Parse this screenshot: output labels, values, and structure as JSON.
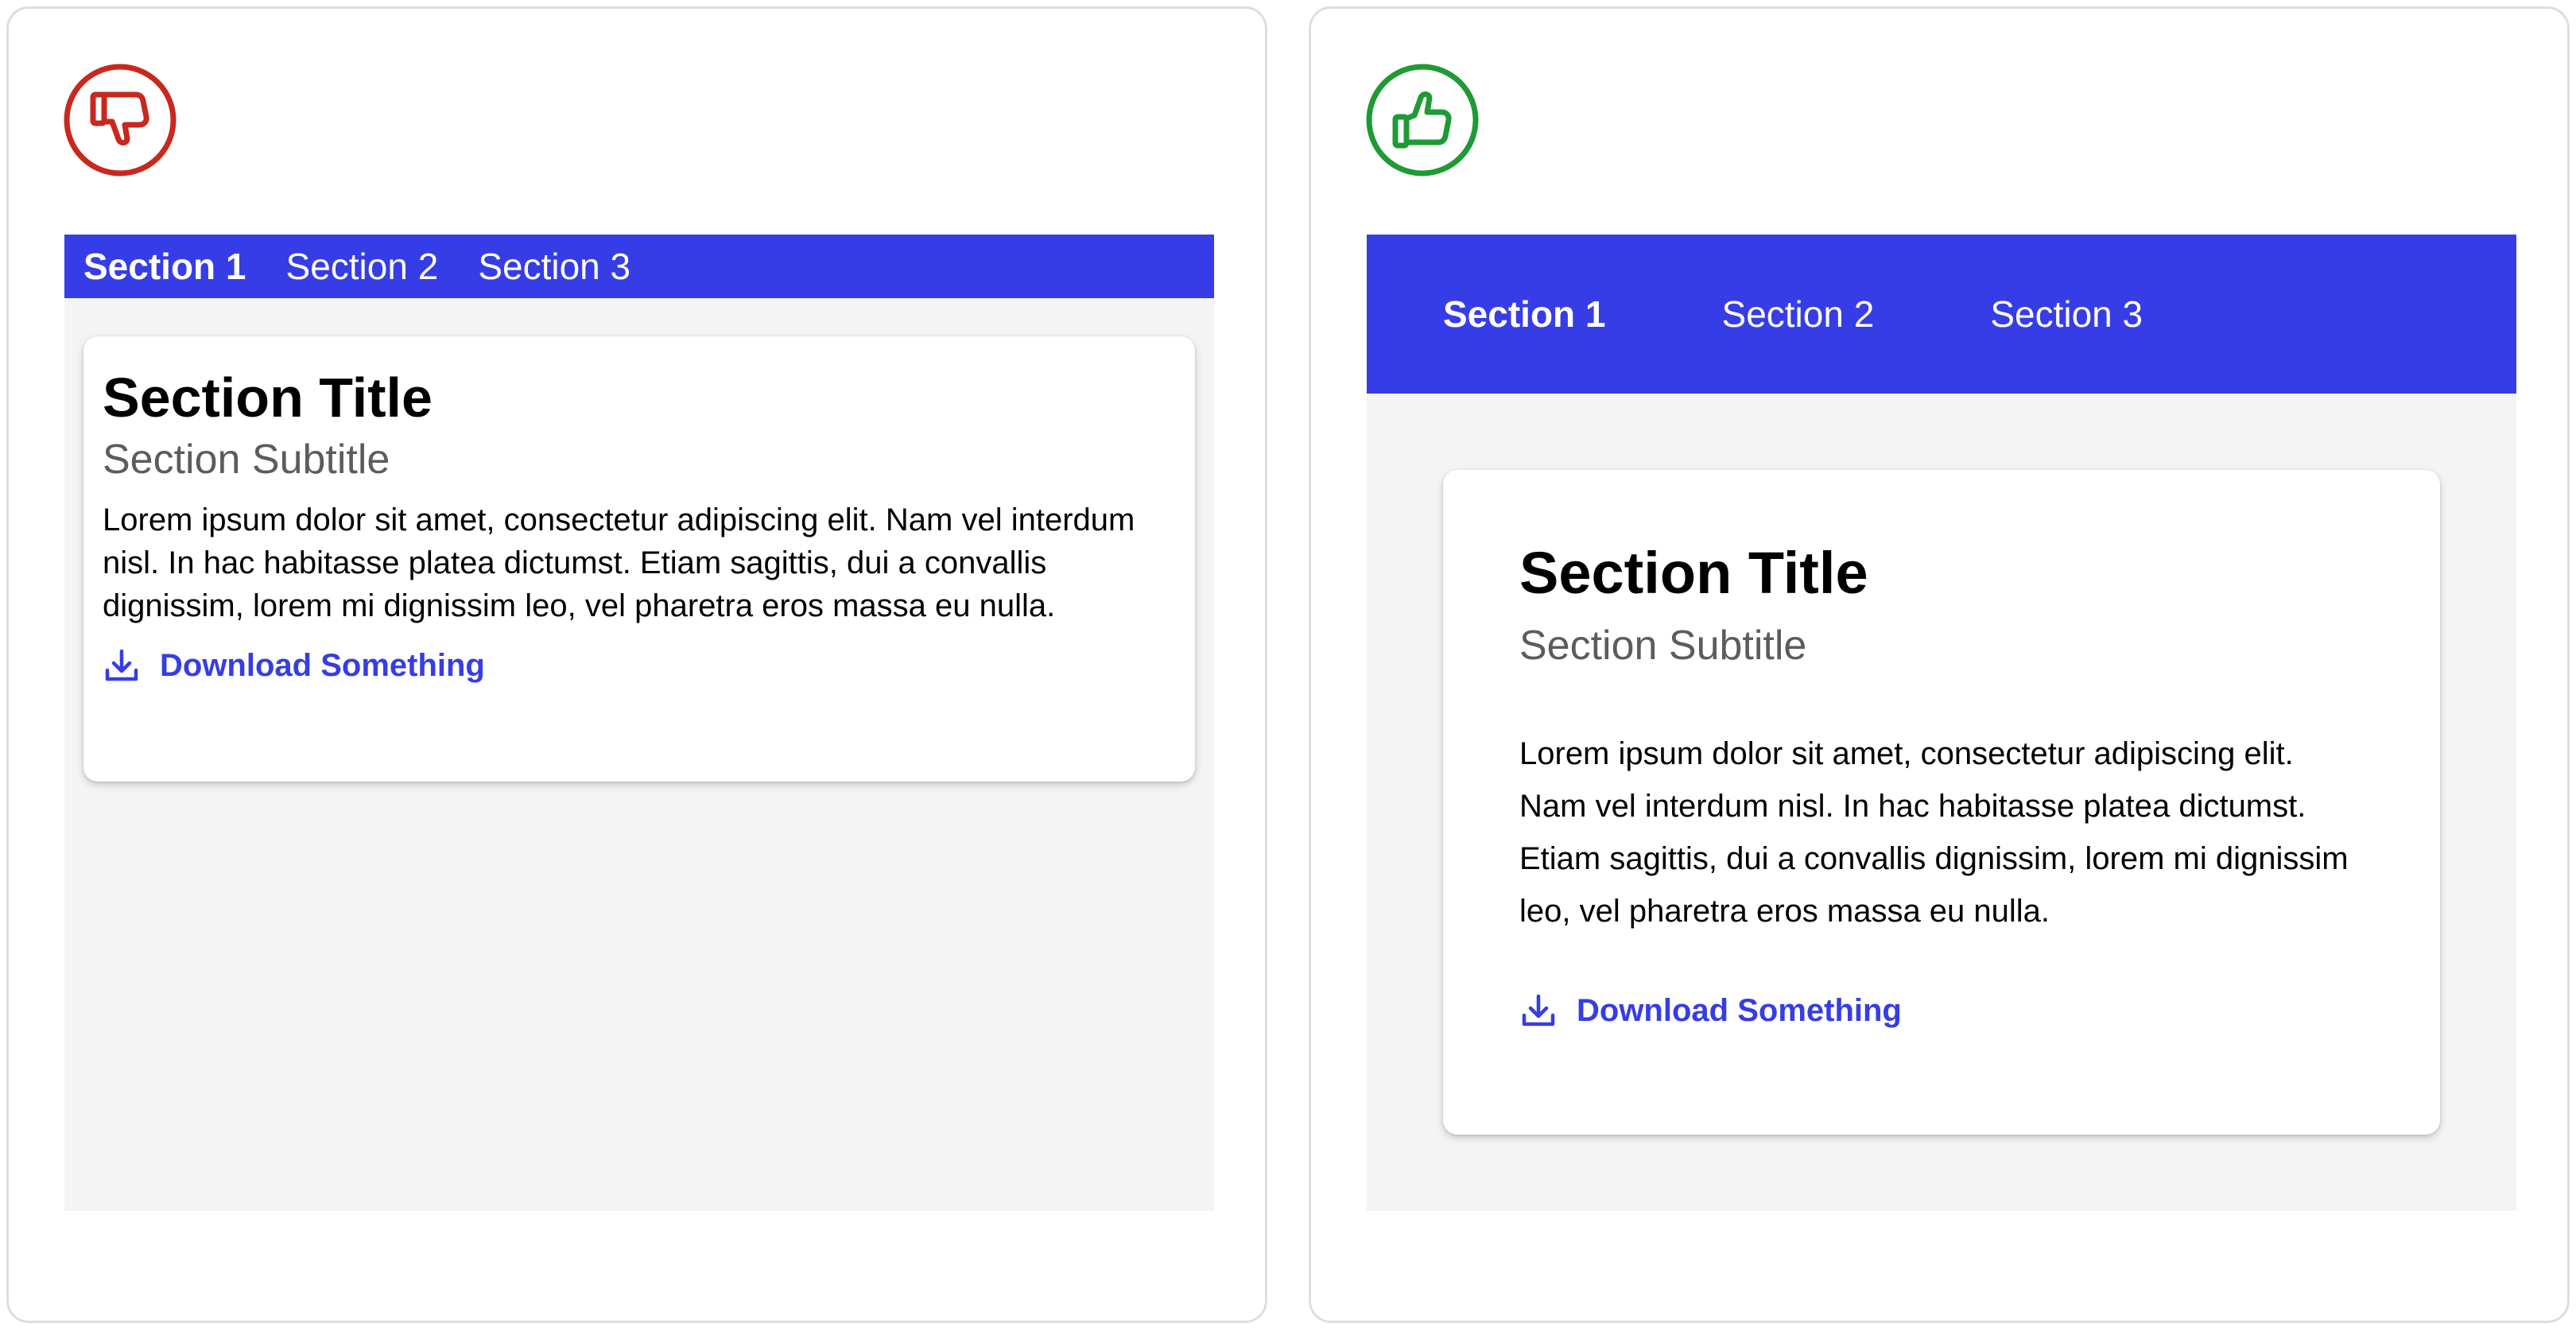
{
  "colors": {
    "nav_background": "#363de6",
    "content_background": "#f4f4f4",
    "link": "#363de6",
    "bad": "#c8281e",
    "good": "#1f9a34",
    "subtitle": "#5c5c5c"
  },
  "bad_example": {
    "verdict_icon": "thumbs-down-icon",
    "tabs": [
      {
        "label": "Section 1",
        "active": true
      },
      {
        "label": "Section 2",
        "active": false
      },
      {
        "label": "Section 3",
        "active": false
      }
    ],
    "card": {
      "title": "Section Title",
      "subtitle": "Section Subtitle",
      "body": "Lorem ipsum dolor sit amet, consectetur adipiscing elit. Nam vel interdum nisl. In hac habitasse platea dictumst. Etiam sagittis, dui a convallis dignissim, lorem mi dignissim leo, vel pharetra eros massa eu nulla.",
      "link_icon": "download-icon",
      "link_label": "Download Something"
    }
  },
  "good_example": {
    "verdict_icon": "thumbs-up-icon",
    "tabs": [
      {
        "label": "Section 1",
        "active": true
      },
      {
        "label": "Section 2",
        "active": false
      },
      {
        "label": "Section 3",
        "active": false
      }
    ],
    "card": {
      "title": "Section Title",
      "subtitle": "Section Subtitle",
      "body": "Lorem ipsum dolor sit amet, consectetur adipiscing elit. Nam vel interdum nisl. In hac habitasse platea dictumst. Etiam sagittis, dui a convallis dignissim, lorem mi dignissim leo, vel pharetra eros massa eu nulla.",
      "link_icon": "download-icon",
      "link_label": "Download Something"
    }
  }
}
